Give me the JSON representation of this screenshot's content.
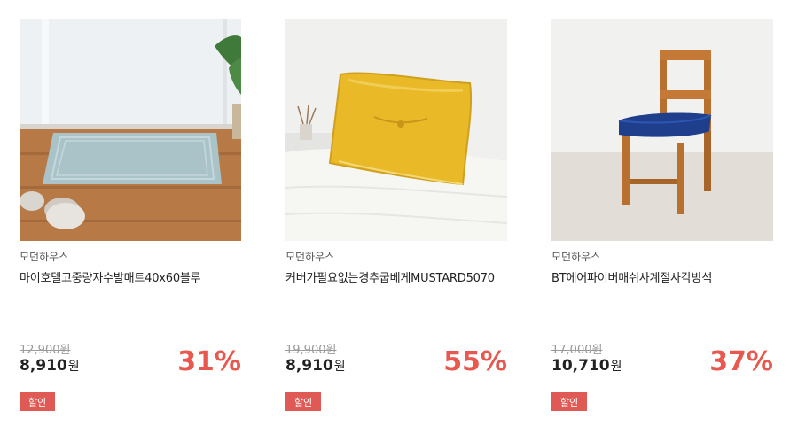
{
  "products": [
    {
      "image": "bath-mat-photo",
      "brand": "모던하우스",
      "name": "마이호텔고중량자수발매트40x60블루",
      "original_price": "12,900원",
      "sale_price": "8,910",
      "currency": "원",
      "discount_rate": "31%",
      "badge": "할인"
    },
    {
      "image": "mustard-pillow-photo",
      "brand": "모던하우스",
      "name": "커버가필요없는경추굽베게MUSTARD5070",
      "original_price": "19,900원",
      "sale_price": "8,910",
      "currency": "원",
      "discount_rate": "55%",
      "badge": "할인"
    },
    {
      "image": "chair-cushion-photo",
      "brand": "모던하우스",
      "name": "BT에어파이버매쉬사계절사각방석",
      "original_price": "17,000원",
      "sale_price": "10,710",
      "currency": "원",
      "discount_rate": "37%",
      "badge": "할인"
    }
  ],
  "colors": {
    "discount": "#e8584f",
    "badge_bg": "#e05a55",
    "strike": "#9a9a9a"
  }
}
